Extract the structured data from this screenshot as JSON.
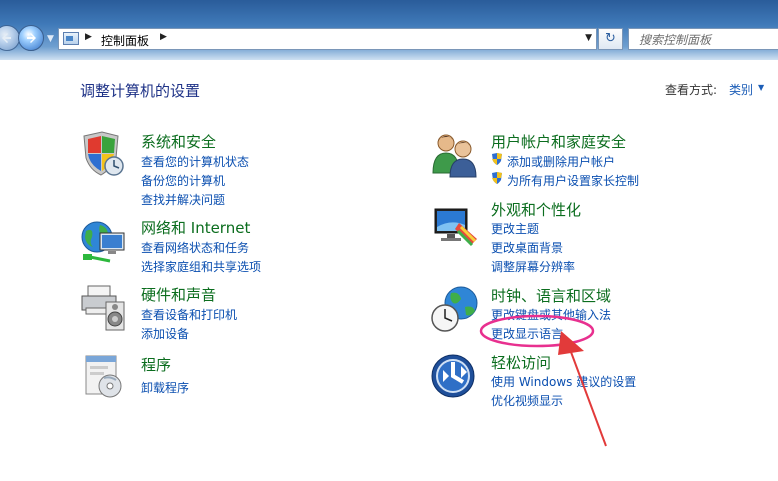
{
  "toolbar": {
    "address_path": "控制面板",
    "search_placeholder": "搜索控制面板"
  },
  "page": {
    "title": "调整计算机的设置",
    "view_by_label": "查看方式:",
    "view_by_value": "类别"
  },
  "categories": [
    {
      "title": "系统和安全",
      "links": [
        "查看您的计算机状态",
        "备份您的计算机",
        "查找并解决问题"
      ]
    },
    {
      "title": "网络和 Internet",
      "links": [
        "查看网络状态和任务",
        "选择家庭组和共享选项"
      ]
    },
    {
      "title": "硬件和声音",
      "links": [
        "查看设备和打印机",
        "添加设备"
      ]
    },
    {
      "title": "程序",
      "links": [
        "卸载程序"
      ]
    },
    {
      "title": "用户帐户和家庭安全",
      "links": [
        "添加或删除用户帐户",
        "为所有用户设置家长控制"
      ]
    },
    {
      "title": "外观和个性化",
      "links": [
        "更改主题",
        "更改桌面背景",
        "调整屏幕分辨率"
      ]
    },
    {
      "title": "时钟、语言和区域",
      "links": [
        "更改键盘或其他输入法",
        "更改显示语言"
      ]
    },
    {
      "title": "轻松访问",
      "links": [
        "使用 Windows 建议的设置",
        "优化视频显示"
      ]
    }
  ],
  "annotation_color": "#e8308f",
  "icons": {
    "back": "back-arrow-icon",
    "forward": "forward-arrow-icon",
    "refresh": "refresh-icon",
    "uac_shield": "uac-shield-icon"
  }
}
